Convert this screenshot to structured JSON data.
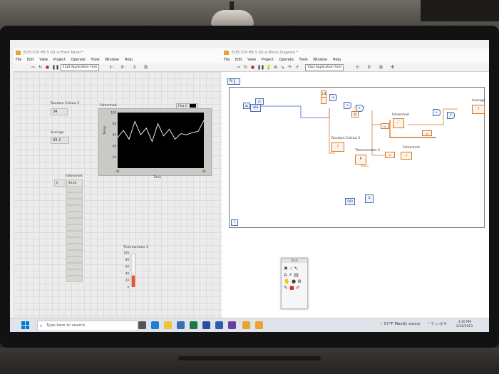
{
  "front_panel": {
    "title": "ELEC370 M5.5 Q2.vi Front Panel *",
    "menu": [
      "File",
      "Edit",
      "View",
      "Project",
      "Operate",
      "Tools",
      "Window",
      "Help"
    ],
    "font_selector": "15pt Application Font",
    "random_celsius_label": "Random Celsius 2",
    "random_celsius_value": "34",
    "average_label": "Average",
    "average_value": "93.2",
    "fahrenheit_array_label": "Fahrenheit",
    "fahrenheit_array_index": "0",
    "fahrenheit_array_first": "93.20",
    "graph": {
      "title": "Fahrenheit",
      "legend": "Plot 0",
      "ylabel": "Temp",
      "xlabel": "Time"
    },
    "thermometer_label": "Thermometer 2"
  },
  "chart_data": {
    "type": "line",
    "title": "Fahrenheit",
    "xlabel": "Time",
    "ylabel": "Temp",
    "xlim": [
      44,
      56
    ],
    "ylim": [
      0,
      100
    ],
    "x_ticks": [
      "44",
      "56"
    ],
    "y_ticks": [
      "100",
      "80",
      "60",
      "40",
      "20"
    ],
    "series": [
      {
        "name": "Plot 0",
        "x": [
          44,
          44.8,
          45.6,
          46.4,
          47.2,
          48,
          48.8,
          49.6,
          50.4,
          51.2,
          52,
          52.8,
          53.6,
          54.4,
          55.2,
          56
        ],
        "values": [
          55,
          68,
          52,
          84,
          60,
          72,
          48,
          80,
          58,
          70,
          52,
          62,
          60,
          64,
          66,
          86
        ]
      }
    ]
  },
  "thermometer_data": {
    "ticks": [
      "100",
      "80",
      "60",
      "40",
      "20",
      "0"
    ],
    "level_percent": 34
  },
  "block_diagram": {
    "title": "ELEC370 M5.5 Q2.vi Block Diagram *",
    "menu": [
      "File",
      "Edit",
      "View",
      "Project",
      "Operate",
      "Tools",
      "Window",
      "Help"
    ],
    "font_selector": "15pt Application Font",
    "labels": {
      "average": "Average",
      "fahrenheit_graph": "Fahrenheit",
      "random_celsius": "Random Celsius 2",
      "thermometer": "Thermometer 2",
      "fahrenheit_array": "Fahrenheit",
      "const_32": "32",
      "const_dbl": "DBL",
      "const_u64": "U64",
      "const_500": "500",
      "const_18": "1.8",
      "loop_count": "N",
      "loop_iter": "i"
    }
  },
  "tools_palette": {
    "title": "Tools"
  },
  "taskbar": {
    "search_placeholder": "Type here to search",
    "weather": "57°F  Mostly sunny",
    "time": "4:30 PM",
    "date": "2/16/2023"
  },
  "colors": {
    "labview_orange": "#e8a42c",
    "plot_background": "#000000",
    "plot_line": "#ffffff",
    "thermometer_fill": "#e8532a",
    "wire_blue": "#3a5fc8",
    "wire_orange": "#d47a2a",
    "taskbar": "#dfe3ea"
  }
}
